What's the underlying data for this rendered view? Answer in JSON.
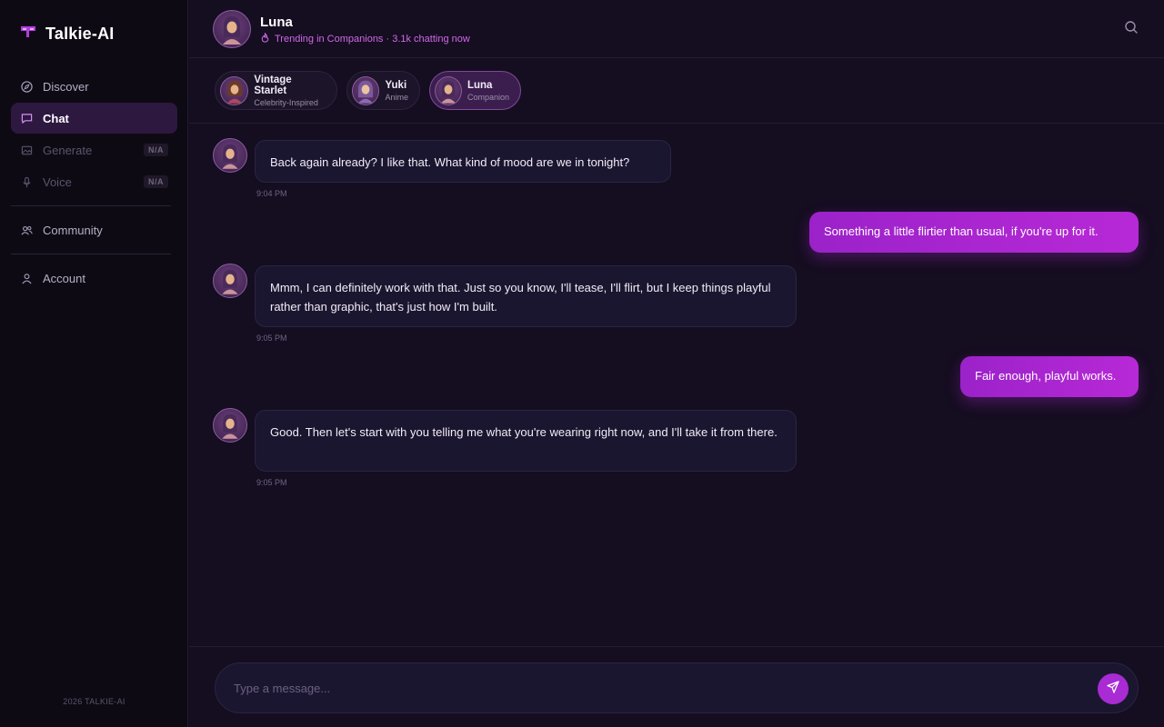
{
  "brand": {
    "name": "Talkie-AI"
  },
  "sidebar": {
    "items": [
      {
        "label": "Discover",
        "icon": "compass-icon",
        "state": "normal"
      },
      {
        "label": "Chat",
        "icon": "chat-icon",
        "state": "active"
      },
      {
        "label": "Generate",
        "icon": "image-icon",
        "state": "disabled",
        "badge": "N/A"
      },
      {
        "label": "Voice",
        "icon": "microphone-icon",
        "state": "disabled",
        "badge": "N/A"
      },
      {
        "label": "Community",
        "icon": "users-icon",
        "state": "normal"
      },
      {
        "label": "Account",
        "icon": "user-icon",
        "state": "normal"
      }
    ],
    "footer": "2026 TALKIE-AI"
  },
  "header": {
    "name": "Luna",
    "status": "Trending in Companions · 3.1k chatting now"
  },
  "chips": [
    {
      "name": "Vintage Starlet",
      "subtitle": "Celebrity-Inspired",
      "active": false
    },
    {
      "name": "Yuki",
      "subtitle": "Anime",
      "active": false
    },
    {
      "name": "Luna",
      "subtitle": "Companion",
      "active": true
    }
  ],
  "messages": [
    {
      "sender": "ai",
      "text": "Back again already? I like that. What kind of mood are we in tonight?",
      "time": "9:04 PM"
    },
    {
      "sender": "user",
      "text": "Something a little flirtier than usual, if you're up for it."
    },
    {
      "sender": "ai",
      "text": "Mmm, I can definitely work with that. Just so you know, I'll tease, I'll flirt, but I keep things playful rather than graphic, that's just how I'm built.",
      "time": "9:05 PM"
    },
    {
      "sender": "user",
      "text": "Fair enough, playful works."
    },
    {
      "sender": "ai",
      "text": "Good. Then let's start with you telling me what you're wearing right now, and I'll take it from there.",
      "time": "9:05 PM"
    }
  ],
  "composer": {
    "placeholder": "Type a message..."
  },
  "colors": {
    "accent": "#a82bd3",
    "status": "#d06ae8",
    "background": "#150d20",
    "sidebar": "#0e0a14"
  }
}
